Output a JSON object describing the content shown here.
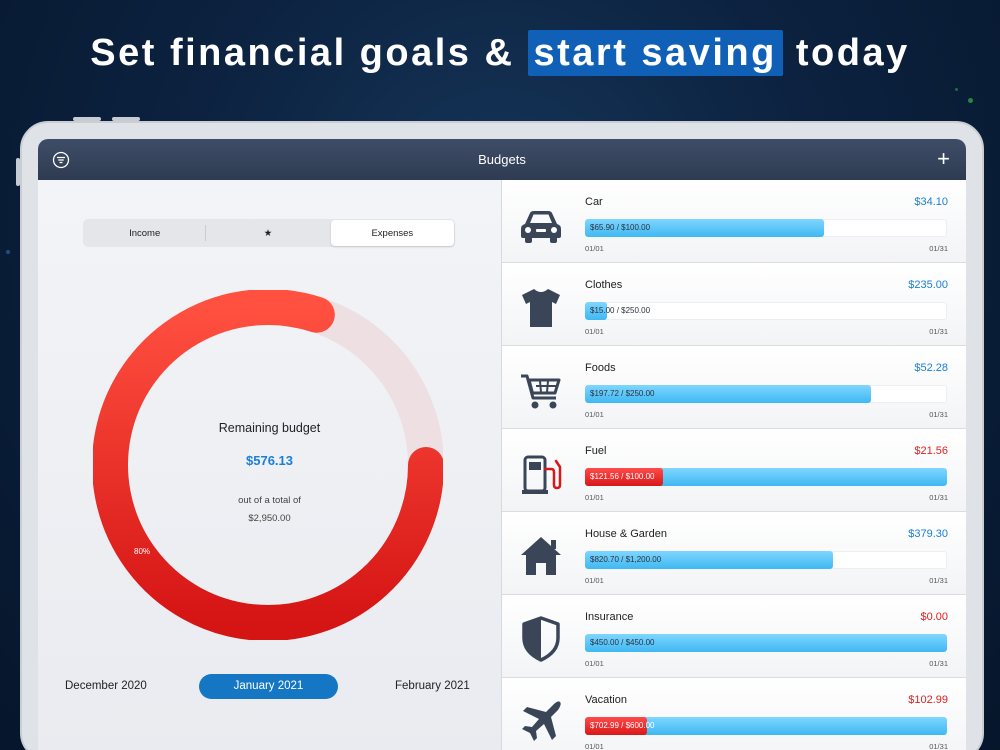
{
  "headline": {
    "before": "Set financial goals & ",
    "highlight": "start saving",
    "after": " today"
  },
  "navbar": {
    "title": "Budgets",
    "filter_icon": "filter-icon",
    "add_label": "+"
  },
  "segment": {
    "income": "Income",
    "favorites": "★",
    "expenses": "Expenses",
    "selected": "Expenses"
  },
  "summary": {
    "remaining_label": "Remaining budget",
    "remaining_value": "$576.13",
    "total_label": "out of a total of",
    "total_value": "$2,950.00",
    "percent_label": "80%",
    "used_fraction": 0.8
  },
  "months": {
    "prev": "December 2020",
    "current": "January 2021",
    "next": "February 2021"
  },
  "colors": {
    "accent_blue": "#1577c4",
    "amount_blue": "#1a7fd6",
    "amount_red": "#e02020",
    "nav": "#34425c",
    "icon": "#3a4658"
  },
  "budgets": [
    {
      "name": "Car",
      "amount": "$34.10",
      "status": "under",
      "bar_text": "$65.90 / $100.00",
      "fill": 0.659,
      "start": "01/01",
      "end": "01/31",
      "icon": "car-icon"
    },
    {
      "name": "Clothes",
      "amount": "$235.00",
      "status": "under",
      "bar_text": "$15.00 / $250.00",
      "fill": 0.06,
      "start": "01/01",
      "end": "01/31",
      "icon": "tshirt-icon"
    },
    {
      "name": "Foods",
      "amount": "$52.28",
      "status": "under",
      "bar_text": "$197.72 / $250.00",
      "fill": 0.791,
      "start": "01/01",
      "end": "01/31",
      "icon": "shopping-cart-icon"
    },
    {
      "name": "Fuel",
      "amount": "$21.56",
      "status": "over",
      "bar_text": "$121.56 / $100.00",
      "fill": 0.215,
      "start": "01/01",
      "end": "01/31",
      "icon": "fuel-pump-icon"
    },
    {
      "name": "House & Garden",
      "amount": "$379.30",
      "status": "under",
      "bar_text": "$820.70 / $1,200.00",
      "fill": 0.684,
      "start": "01/01",
      "end": "01/31",
      "icon": "house-icon"
    },
    {
      "name": "Insurance",
      "amount": "$0.00",
      "status": "over",
      "bar_text": "$450.00 / $450.00",
      "fill": 1.0,
      "start": "01/01",
      "end": "01/31",
      "icon": "shield-icon"
    },
    {
      "name": "Vacation",
      "amount": "$102.99",
      "status": "over",
      "bar_text": "$702.99 / $600.00",
      "fill": 0.171,
      "start": "01/01",
      "end": "01/31",
      "icon": "airplane-icon"
    }
  ]
}
